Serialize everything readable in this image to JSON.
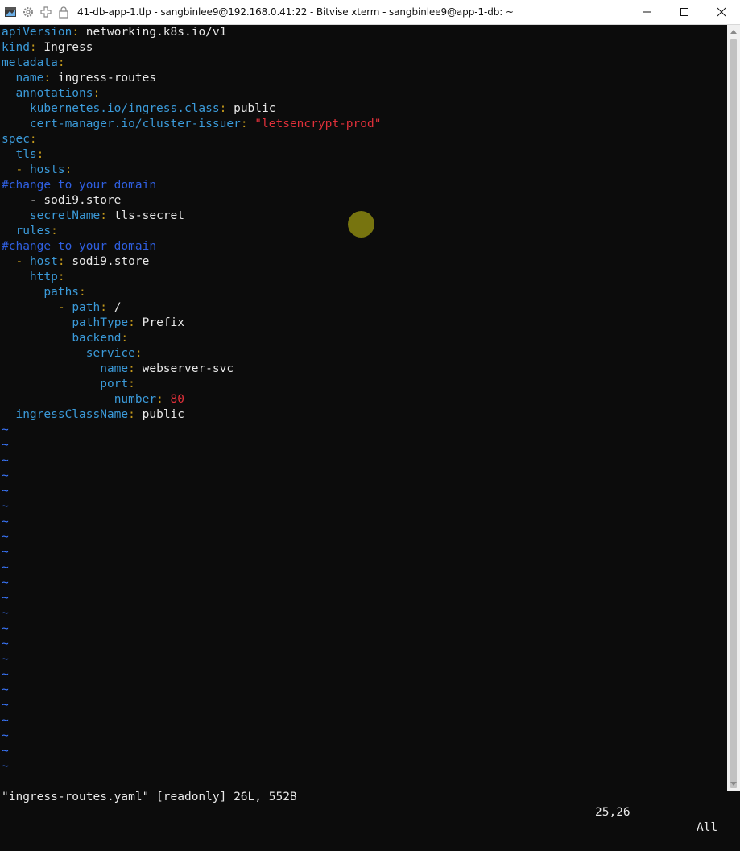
{
  "window": {
    "title": "41-db-app-1.tlp - sangbinlee9@192.168.0.41:22 - Bitvise xterm - sangbinlee9@app-1-db: ~"
  },
  "editor": {
    "lines": [
      [
        [
          "k",
          "apiVersion"
        ],
        [
          "p",
          ": "
        ],
        [
          "v",
          "networking.k8s.io/v1"
        ]
      ],
      [
        [
          "k",
          "kind"
        ],
        [
          "p",
          ": "
        ],
        [
          "v",
          "Ingress"
        ]
      ],
      [
        [
          "k",
          "metadata"
        ],
        [
          "p",
          ":"
        ]
      ],
      [
        [
          "v",
          "  "
        ],
        [
          "k",
          "name"
        ],
        [
          "p",
          ": "
        ],
        [
          "v",
          "ingress-routes"
        ]
      ],
      [
        [
          "v",
          "  "
        ],
        [
          "k",
          "annotations"
        ],
        [
          "p",
          ":"
        ]
      ],
      [
        [
          "v",
          "    "
        ],
        [
          "k",
          "kubernetes.io/ingress.class"
        ],
        [
          "p",
          ": "
        ],
        [
          "v",
          "public"
        ]
      ],
      [
        [
          "v",
          "    "
        ],
        [
          "k",
          "cert-manager.io/cluster-issuer"
        ],
        [
          "p",
          ": "
        ],
        [
          "s",
          "\"letsencrypt-prod\""
        ]
      ],
      [
        [
          "k",
          "spec"
        ],
        [
          "p",
          ":"
        ]
      ],
      [
        [
          "v",
          "  "
        ],
        [
          "k",
          "tls"
        ],
        [
          "p",
          ":"
        ]
      ],
      [
        [
          "v",
          "  "
        ],
        [
          "p",
          "- "
        ],
        [
          "k",
          "hosts"
        ],
        [
          "p",
          ":"
        ]
      ],
      [
        [
          "c",
          "#change to your domain"
        ]
      ],
      [
        [
          "v",
          "    - sodi9.store"
        ]
      ],
      [
        [
          "v",
          "    "
        ],
        [
          "k",
          "secretName"
        ],
        [
          "p",
          ": "
        ],
        [
          "v",
          "tls-secret"
        ]
      ],
      [
        [
          "v",
          "  "
        ],
        [
          "k",
          "rules"
        ],
        [
          "p",
          ":"
        ]
      ],
      [
        [
          "c",
          "#change to your domain"
        ]
      ],
      [
        [
          "v",
          "  "
        ],
        [
          "p",
          "- "
        ],
        [
          "k",
          "host"
        ],
        [
          "p",
          ": "
        ],
        [
          "v",
          "sodi9.store"
        ]
      ],
      [
        [
          "v",
          "    "
        ],
        [
          "k",
          "http"
        ],
        [
          "p",
          ":"
        ]
      ],
      [
        [
          "v",
          "      "
        ],
        [
          "k",
          "paths"
        ],
        [
          "p",
          ":"
        ]
      ],
      [
        [
          "v",
          "        "
        ],
        [
          "p",
          "- "
        ],
        [
          "k",
          "path"
        ],
        [
          "p",
          ": "
        ],
        [
          "v",
          "/"
        ]
      ],
      [
        [
          "v",
          "          "
        ],
        [
          "k",
          "pathType"
        ],
        [
          "p",
          ": "
        ],
        [
          "v",
          "Prefix"
        ]
      ],
      [
        [
          "v",
          "          "
        ],
        [
          "k",
          "backend"
        ],
        [
          "p",
          ":"
        ]
      ],
      [
        [
          "v",
          "            "
        ],
        [
          "k",
          "service"
        ],
        [
          "p",
          ":"
        ]
      ],
      [
        [
          "v",
          "              "
        ],
        [
          "k",
          "name"
        ],
        [
          "p",
          ": "
        ],
        [
          "v",
          "webserver-svc"
        ]
      ],
      [
        [
          "v",
          "              "
        ],
        [
          "k",
          "port"
        ],
        [
          "p",
          ":"
        ]
      ],
      [
        [
          "v",
          "                "
        ],
        [
          "k",
          "number"
        ],
        [
          "p",
          ": "
        ],
        [
          "n",
          "80"
        ]
      ],
      [
        [
          "v",
          "  "
        ],
        [
          "k",
          "ingressClassName"
        ],
        [
          "p",
          ": "
        ],
        [
          "v",
          "public"
        ]
      ]
    ],
    "empty_marker": "~"
  },
  "status": {
    "file": "\"ingress-routes.yaml\" [readonly] 26L, 552B",
    "position": "25,26",
    "scroll": "All"
  },
  "colors": {
    "key": "#3b9ad9",
    "punct": "#c59a1c",
    "string": "#e0303a",
    "comment": "#2f5fe0",
    "tilde": "#3b78ff",
    "background": "#0c0c0c"
  }
}
